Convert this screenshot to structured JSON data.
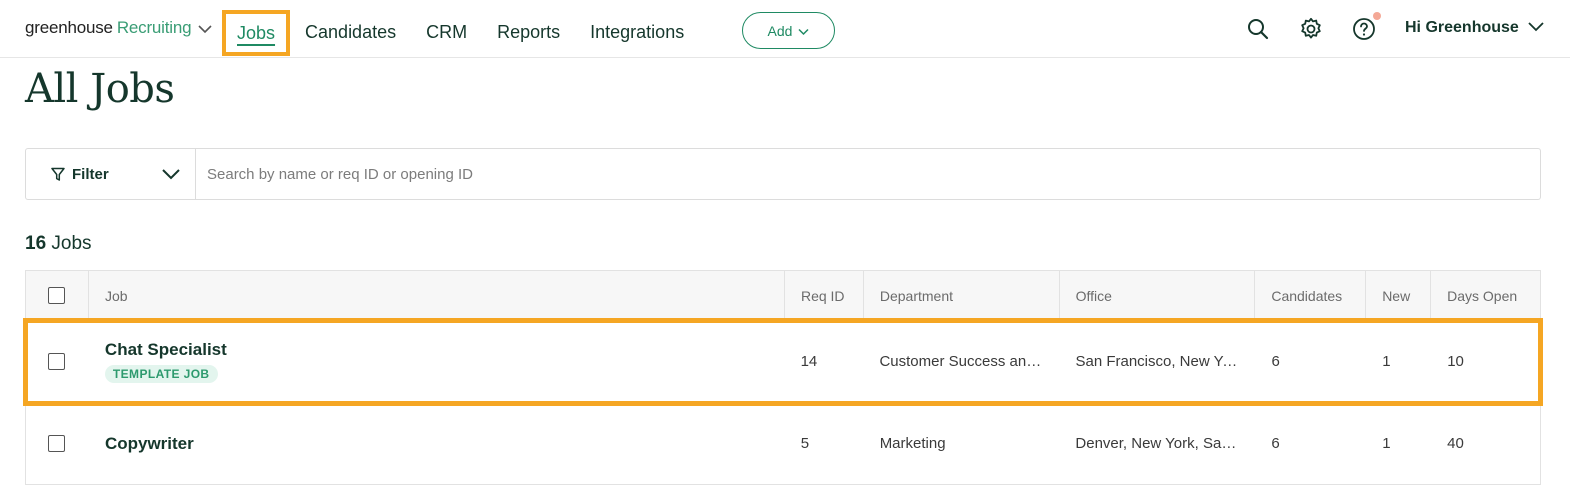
{
  "brand": {
    "name": "greenhouse",
    "product": "Recruiting"
  },
  "nav": [
    {
      "label": "Jobs",
      "active": true
    },
    {
      "label": "Candidates"
    },
    {
      "label": "CRM"
    },
    {
      "label": "Reports"
    },
    {
      "label": "Integrations"
    }
  ],
  "add_button": {
    "label": "Add"
  },
  "user": {
    "greeting": "Hi Greenhouse"
  },
  "page": {
    "title": "All Jobs"
  },
  "filter": {
    "label": "Filter",
    "search_placeholder": "Search by name or req ID or opening ID"
  },
  "job_count": {
    "count": "16",
    "label": "Jobs"
  },
  "table": {
    "columns": [
      "Job",
      "Req ID",
      "Department",
      "Office",
      "Candidates",
      "New",
      "Days Open"
    ],
    "rows": [
      {
        "job": "Chat Specialist",
        "badge": "TEMPLATE JOB",
        "req_id": "14",
        "department": "Customer Success and Support",
        "office": "San Francisco, New York",
        "candidates": "6",
        "new": "1",
        "days_open": "10"
      },
      {
        "job": "Copywriter",
        "req_id": "5",
        "department": "Marketing",
        "office": "Denver, New York, San Francisco",
        "candidates": "6",
        "new": "1",
        "days_open": "40"
      }
    ]
  },
  "colors": {
    "accent": "#1f8a63",
    "highlight": "#f5a623",
    "text": "#15372c"
  }
}
